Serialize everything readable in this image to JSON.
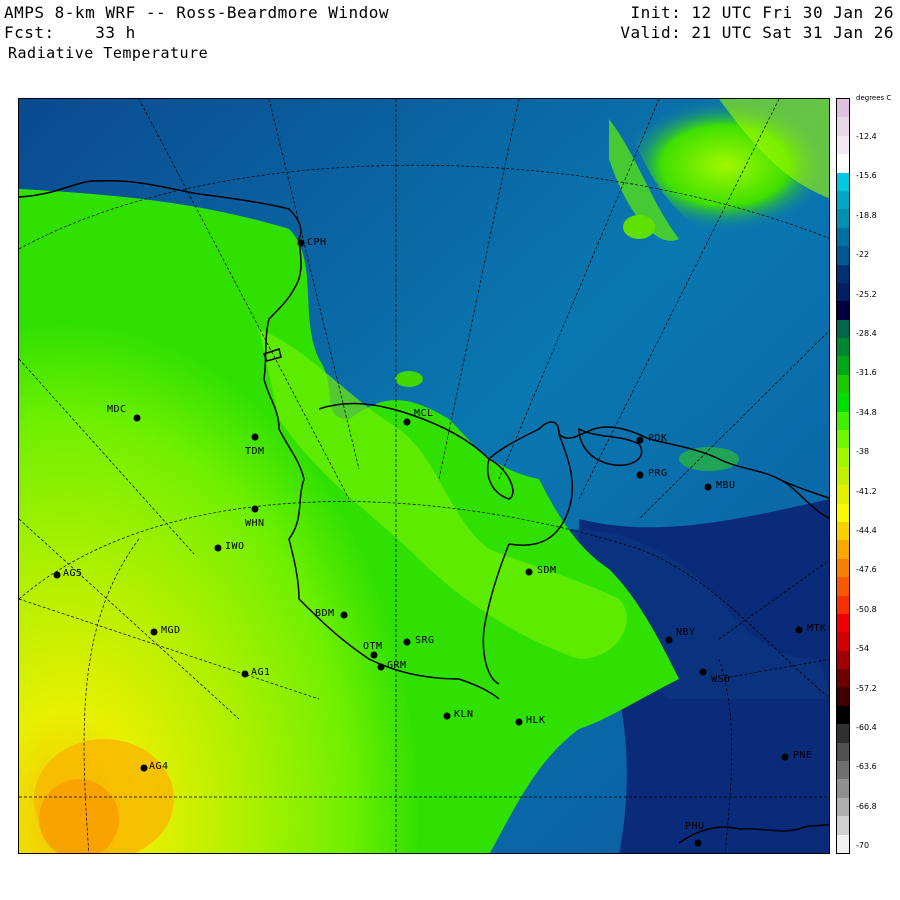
{
  "header": {
    "title": "AMPS 8-km WRF -- Ross-Beardmore Window",
    "forecast": "Fcst:    33 h",
    "field": "Radiative Temperature",
    "init": "Init: 12 UTC Fri 30 Jan 26",
    "valid": "Valid: 21 UTC Sat 31 Jan 26"
  },
  "colorbar": {
    "units": "degrees C",
    "ticks": [
      "-12.4",
      "-15.6",
      "-18.8",
      "-22",
      "-25.2",
      "-28.4",
      "-31.6",
      "-34.8",
      "-38",
      "-41.2",
      "-44.4",
      "-47.6",
      "-50.8",
      "-54",
      "-57.2",
      "-60.4",
      "-63.6",
      "-66.8",
      "-70"
    ],
    "colors": [
      "#e0c0e0",
      "#ead6ea",
      "#f4e8f4",
      "#ffffff",
      "#00c8e0",
      "#00a8c8",
      "#0090b0",
      "#0070a0",
      "#005890",
      "#003070",
      "#002060",
      "#000040",
      "#006848",
      "#008830",
      "#00a818",
      "#20c800",
      "#00e000",
      "#40f000",
      "#70f800",
      "#a0f800",
      "#c0f000",
      "#e0f000",
      "#f8f800",
      "#f8d000",
      "#f8a800",
      "#f88000",
      "#f85800",
      "#f83000",
      "#f00000",
      "#d00000",
      "#a00000",
      "#700000",
      "#400000",
      "#000000",
      "#303030",
      "#505050",
      "#707070",
      "#909090",
      "#b0b0b0",
      "#d0d0d0",
      "#f0f0f0"
    ]
  },
  "stations": [
    {
      "id": "CPH"
    },
    {
      "id": "MDC"
    },
    {
      "id": "TDM"
    },
    {
      "id": "WHN"
    },
    {
      "id": "IWO"
    },
    {
      "id": "AG5"
    },
    {
      "id": "MGD"
    },
    {
      "id": "AG1"
    },
    {
      "id": "AG4"
    },
    {
      "id": "BDM"
    },
    {
      "id": "OTM"
    },
    {
      "id": "GRM"
    },
    {
      "id": "SRG"
    },
    {
      "id": "KLN"
    },
    {
      "id": "HLK"
    },
    {
      "id": "SDM"
    },
    {
      "id": "NBY"
    },
    {
      "id": "WSD"
    },
    {
      "id": "MTK"
    },
    {
      "id": "PNE"
    },
    {
      "id": "PHU"
    },
    {
      "id": "MCL"
    },
    {
      "id": "PDK"
    },
    {
      "id": "PRG"
    },
    {
      "id": "MBU"
    }
  ]
}
